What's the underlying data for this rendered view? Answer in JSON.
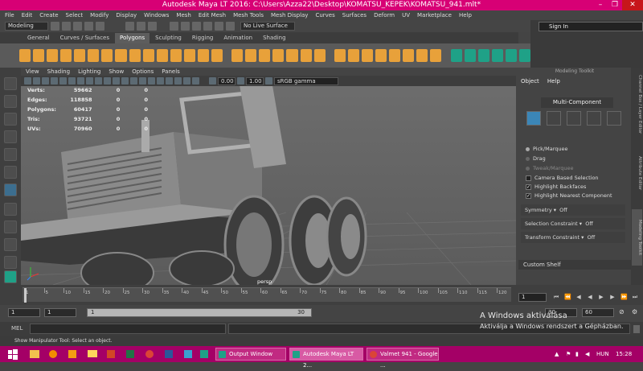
{
  "title": "Autodesk Maya LT 2016: C:\\Users\\Azza22\\Desktop\\KOMATSU_KEPEK\\KOMATSU_941.mlt*",
  "window_controls": {
    "minimize": "–",
    "maximize": "❐",
    "close": "✕"
  },
  "menubar": [
    "File",
    "Edit",
    "Create",
    "Select",
    "Modify",
    "Display",
    "Windows",
    "Mesh",
    "Edit Mesh",
    "Mesh Tools",
    "Mesh Display",
    "Curves",
    "Surfaces",
    "Deform",
    "UV",
    "Marketplace",
    "Help"
  ],
  "status": {
    "mode": "Modeling",
    "live_surface": "No Live Surface",
    "sign_in": "Sign In"
  },
  "shelf_tabs": [
    "General",
    "Curves / Surfaces",
    "Polygons",
    "Sculpting",
    "Rigging",
    "Animation",
    "Shading"
  ],
  "active_shelf_tab": "Polygons",
  "viewport": {
    "menu": [
      "View",
      "Shading",
      "Lighting",
      "Show",
      "Options",
      "Panels"
    ],
    "field1": "0.00",
    "field2": "1.00",
    "color_space": "sRGB gamma",
    "camera": "persp",
    "hud": [
      {
        "label": "Verts:",
        "value": "59662",
        "sel": "0",
        "comp": "0"
      },
      {
        "label": "Edges:",
        "value": "118858",
        "sel": "0",
        "comp": "0"
      },
      {
        "label": "Polygons:",
        "value": "60417",
        "sel": "0",
        "comp": "0"
      },
      {
        "label": "Tris:",
        "value": "93721",
        "sel": "0",
        "comp": "0"
      },
      {
        "label": "UVs:",
        "value": "70960",
        "sel": "0",
        "comp": "0"
      }
    ]
  },
  "toolkit": {
    "title": "Modeling Toolkit",
    "menu": [
      "Object",
      "Help"
    ],
    "multi_component": "Multi-Component",
    "options": {
      "pick_marquee": "Pick/Marquee",
      "drag": "Drag",
      "tweak_marquee": "Tweak/Marquee",
      "camera_based": "Camera Based Selection",
      "highlight_backfaces": "Highlight Backfaces",
      "highlight_nearest": "Highlight Nearest Component"
    },
    "sections": [
      {
        "label": "Symmetry",
        "value": "Off"
      },
      {
        "label": "Selection Constraint",
        "value": "Off"
      },
      {
        "label": "Transform Constraint",
        "value": "Off"
      }
    ],
    "custom_shelf": "Custom Shelf"
  },
  "side_tabs": [
    "Channel Box / Layer Editor",
    "Attribute Editor",
    "Modeling Toolkit"
  ],
  "timeline": {
    "labels": [
      "1",
      "5",
      "10",
      "15",
      "20",
      "25",
      "30",
      "35",
      "40",
      "45",
      "50",
      "55",
      "60",
      "65",
      "70",
      "75",
      "80",
      "85",
      "90",
      "95",
      "100",
      "105",
      "110",
      "115",
      "120"
    ],
    "current_frame": "1"
  },
  "range": {
    "start1": "1",
    "start2": "1",
    "bar_start": "1",
    "bar_end": "30",
    "end1": "30",
    "end2": "60"
  },
  "command": {
    "label": "MEL"
  },
  "help_line": "Show Manipulator Tool: Select an object.",
  "watermark": {
    "line1": "A Windows aktiválása",
    "line2": "Aktiválja a Windows rendszert a Gépházban."
  },
  "taskbar": {
    "windows": [
      "Output Window",
      "Autodesk Maya LT 2...",
      "Valmet 941 - Google ..."
    ],
    "lang": "HUN",
    "time": "15:28"
  },
  "colors": {
    "title_bg": "#d70075",
    "taskbar_bg": "#a40066",
    "shelf_icon": "#e8a13a",
    "shelf_icon_alt": "#1fa187",
    "selected": "#3b86b7"
  }
}
